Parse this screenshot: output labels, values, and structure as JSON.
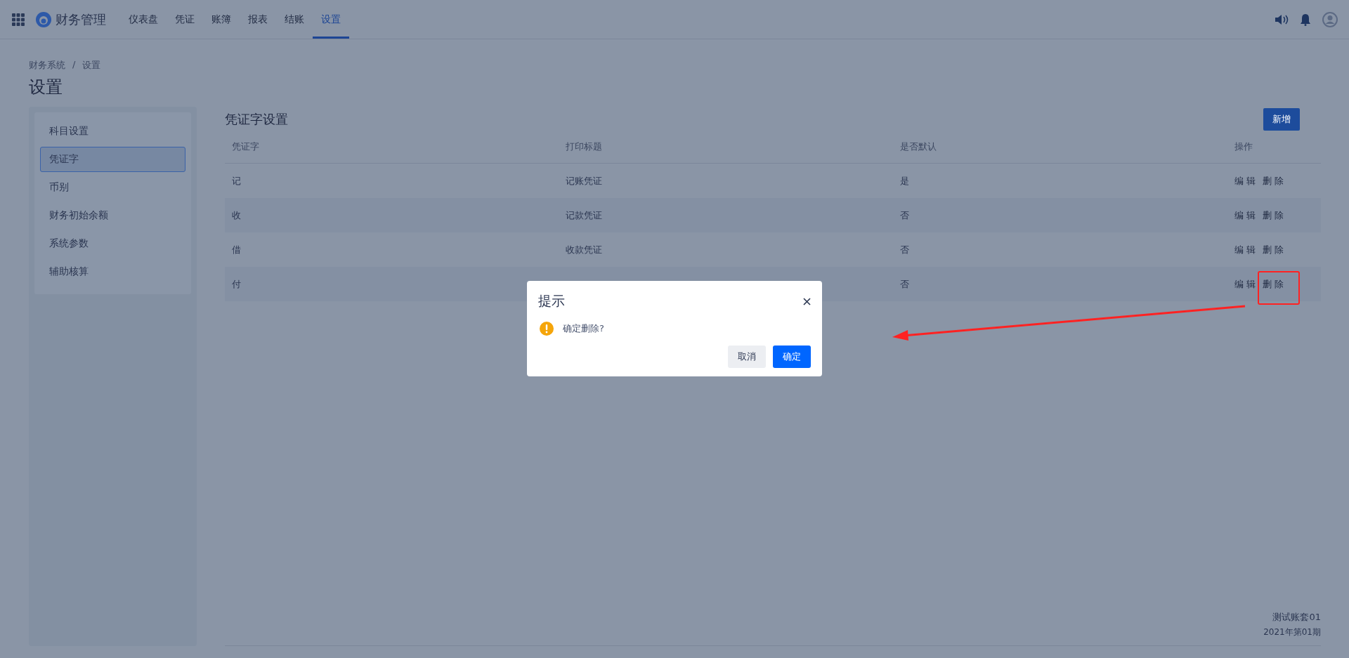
{
  "app": {
    "name": "财务管理"
  },
  "nav": [
    {
      "label": "仪表盘",
      "selected": false
    },
    {
      "label": "凭证",
      "selected": false
    },
    {
      "label": "账簿",
      "selected": false
    },
    {
      "label": "报表",
      "selected": false
    },
    {
      "label": "结账",
      "selected": false
    },
    {
      "label": "设置",
      "selected": true
    }
  ],
  "breadcrumb": [
    "财务系统",
    "设置"
  ],
  "breadcrumb_separator": "/",
  "page_title": "设置",
  "sidebar": {
    "items": [
      {
        "label": "科目设置",
        "selected": false
      },
      {
        "label": "凭证字",
        "selected": true
      },
      {
        "label": "币别",
        "selected": false
      },
      {
        "label": "财务初始余额",
        "selected": false
      },
      {
        "label": "系统参数",
        "selected": false
      },
      {
        "label": "辅助核算",
        "selected": false
      }
    ]
  },
  "section": {
    "title": "凭证字设置",
    "add_button": "新增"
  },
  "table": {
    "columns": [
      "凭证字",
      "打印标题",
      "是否默认",
      "操作"
    ],
    "rows": [
      {
        "code": "记",
        "print_title": "记账凭证",
        "is_default": "是",
        "actions": [
          "编 辑",
          "删 除"
        ]
      },
      {
        "code": "收",
        "print_title": "记款凭证",
        "is_default": "否",
        "actions": [
          "编 辑",
          "删 除"
        ]
      },
      {
        "code": "借",
        "print_title": "收款凭证",
        "is_default": "否",
        "actions": [
          "编 辑",
          "删 除"
        ]
      },
      {
        "code": "付",
        "is_default": "否",
        "actions": [
          "编 辑",
          "删 除"
        ]
      }
    ]
  },
  "footer": {
    "account": "测试账套01",
    "period": "2021年第01期"
  },
  "dialog": {
    "title": "提示",
    "message": "确定删除?",
    "buttons": [
      {
        "label": "取消",
        "kind": "secondary"
      },
      {
        "label": "确定",
        "kind": "primary"
      }
    ]
  }
}
